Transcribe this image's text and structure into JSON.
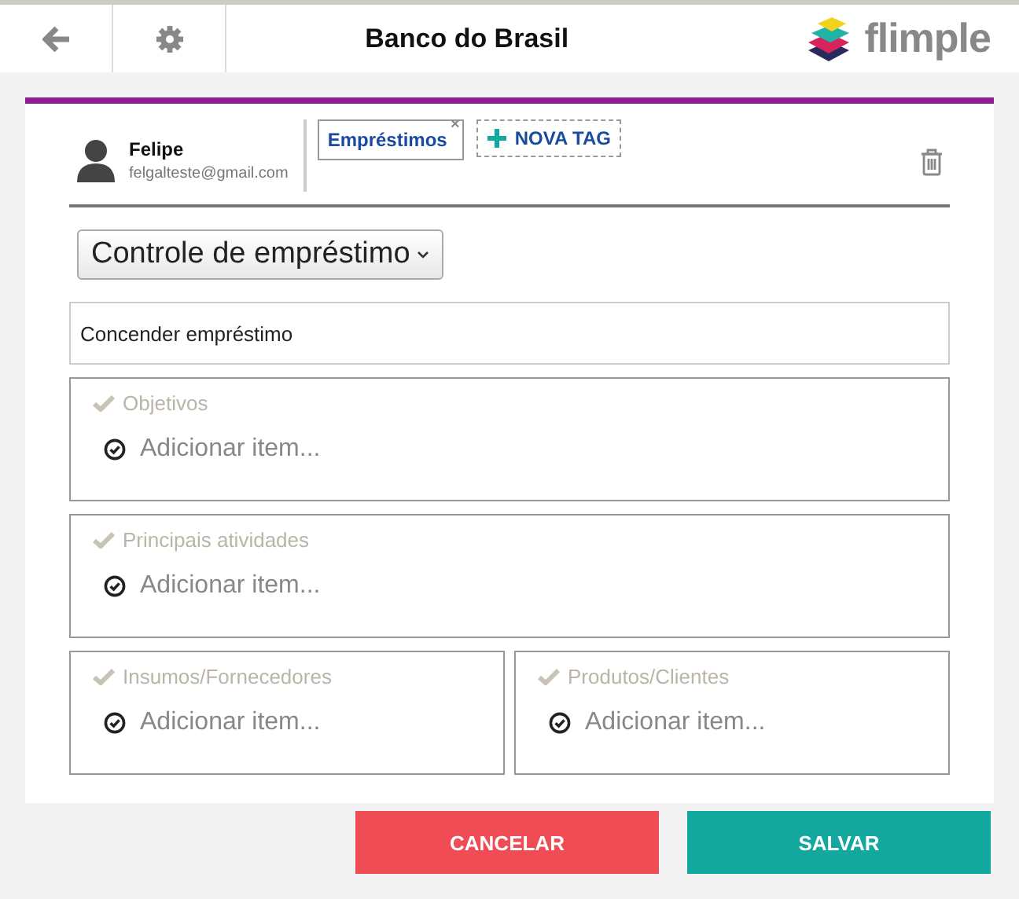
{
  "header": {
    "title": "Banco do Brasil",
    "logo_text": "flimple"
  },
  "user": {
    "name": "Felipe",
    "email": "felgalteste@gmail.com"
  },
  "tags": [
    {
      "label": "Empréstimos",
      "remove": "×"
    }
  ],
  "new_tag": {
    "label": "NOVA TAG"
  },
  "template_select": {
    "value": "Controle de empréstimo"
  },
  "title_field": {
    "value": "Concender empréstimo"
  },
  "section_rows": [
    [
      {
        "title": "Objetivos",
        "placeholder": "Adicionar item..."
      }
    ],
    [
      {
        "title": "Principais atividades",
        "placeholder": "Adicionar item..."
      }
    ],
    [
      {
        "title": "Insumos/Fornecedores",
        "placeholder": "Adicionar item..."
      },
      {
        "title": "Produtos/Clientes",
        "placeholder": "Adicionar item..."
      }
    ]
  ],
  "buttons": [
    {
      "kind": "cancel",
      "label": "CANCELAR"
    },
    {
      "kind": "save",
      "label": "SALVAR"
    }
  ]
}
